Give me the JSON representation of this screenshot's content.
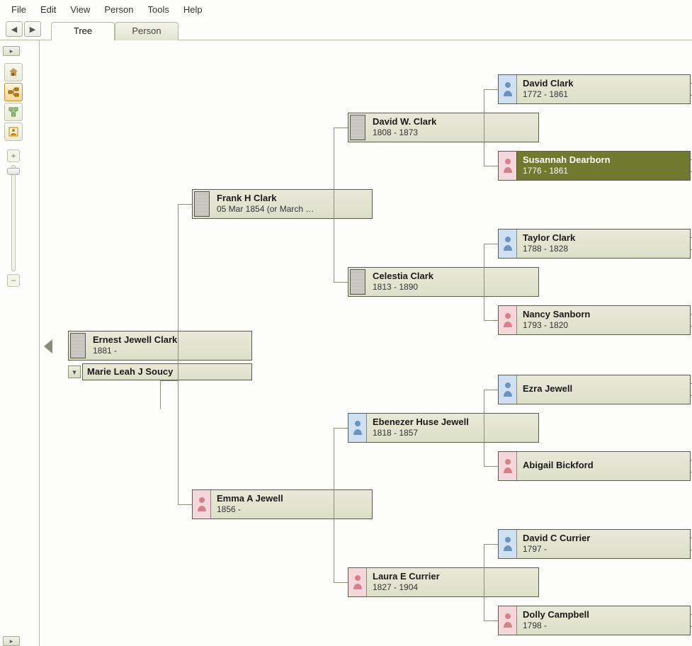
{
  "menu": {
    "file": "File",
    "edit": "Edit",
    "view": "View",
    "person": "Person",
    "tools": "Tools",
    "help": "Help"
  },
  "nav": {
    "back_glyph": "◀",
    "forward_glyph": "▶"
  },
  "tabs": {
    "tree": "Tree",
    "person": "Person"
  },
  "people": {
    "root": {
      "name": "Ernest Jewell Clark",
      "dates": "1881 -"
    },
    "spouse": {
      "name": "Marie Leah J Soucy",
      "dates": ""
    },
    "father": {
      "name": "Frank H Clark",
      "dates": "05 Mar 1854 (or March …"
    },
    "mother": {
      "name": "Emma A Jewell",
      "dates": "1856 -"
    },
    "pgf": {
      "name": "David W. Clark",
      "dates": "1808 - 1873"
    },
    "pgm": {
      "name": "Celestia Clark",
      "dates": "1813 - 1890"
    },
    "mgf": {
      "name": "Ebenezer Huse Jewell",
      "dates": "1818 - 1857"
    },
    "mgm": {
      "name": "Laura E Currier",
      "dates": "1827 - 1904"
    },
    "pggf1": {
      "name": "David Clark",
      "dates": "1772 - 1861"
    },
    "pggm1": {
      "name": "Susannah Dearborn",
      "dates": "1776 - 1861"
    },
    "pggf2": {
      "name": "Taylor Clark",
      "dates": "1788 - 1828"
    },
    "pggm2": {
      "name": "Nancy Sanborn",
      "dates": "1793 - 1820"
    },
    "mggf1": {
      "name": "Ezra Jewell",
      "dates": ""
    },
    "mggm1": {
      "name": "Abigail Bickford",
      "dates": ""
    },
    "mggf2": {
      "name": "David C Currier",
      "dates": "1797 -"
    },
    "mggm2": {
      "name": "Dolly Campbell",
      "dates": "1798 -"
    }
  }
}
